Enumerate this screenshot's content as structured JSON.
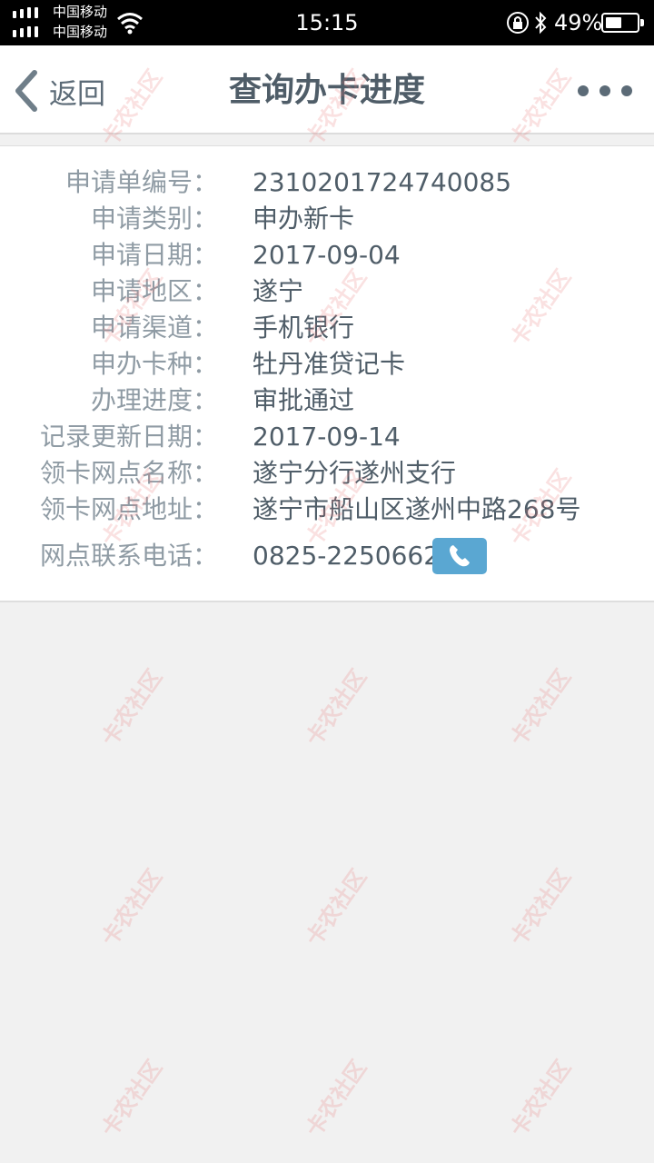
{
  "status_bar": {
    "carrier_1": "中国移动",
    "carrier_2": "中国移动",
    "time": "15:15",
    "battery_percent": "49%",
    "battery_level": 0.49
  },
  "nav": {
    "back_label": "返回",
    "title": "查询办卡进度",
    "more_icon": "more-dots-icon"
  },
  "details": [
    {
      "label": "申请单编号：",
      "value": "2310201724740085"
    },
    {
      "label": "申请类别：",
      "value": "申办新卡"
    },
    {
      "label": "申请日期：",
      "value": "2017-09-04"
    },
    {
      "label": "申请地区：",
      "value": "遂宁"
    },
    {
      "label": "申请渠道：",
      "value": "手机银行"
    },
    {
      "label": "申办卡种：",
      "value": "牡丹准贷记卡"
    },
    {
      "label": "办理进度：",
      "value": "审批通过"
    },
    {
      "label": "记录更新日期：",
      "value": "2017-09-14"
    },
    {
      "label": "领卡网点名称：",
      "value": "遂宁分行遂州支行"
    },
    {
      "label": "领卡网点地址：",
      "value": "遂宁市船山区遂州中路268号"
    },
    {
      "label": "网点联系电话：",
      "value": "0825-2250662"
    }
  ],
  "watermark": "卡农社区",
  "colors": {
    "accent_blue": "#5aa7d2",
    "label_gray": "#8f9ba4",
    "value_dark": "#4f5d68",
    "background": "#f1f1f1"
  }
}
